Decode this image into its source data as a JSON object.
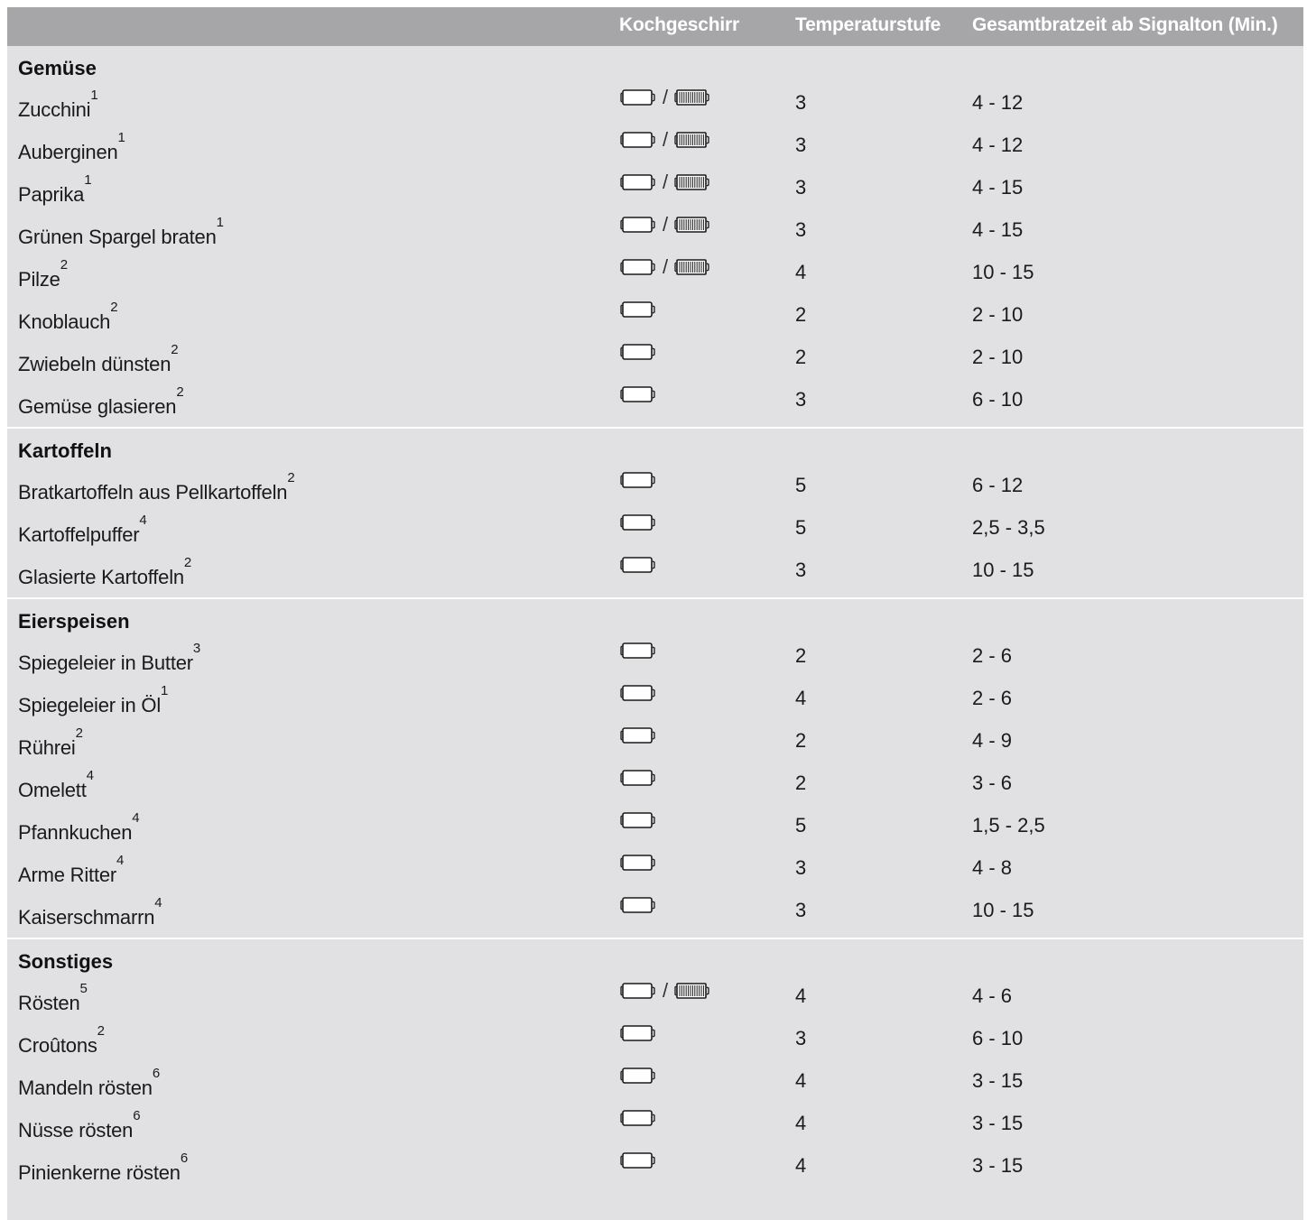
{
  "header": {
    "col1": "",
    "col2": "Kochgeschirr",
    "col3": "Temperaturstufe",
    "col4": "Gesamtbratzeit ab Signalton (Min.)"
  },
  "icons": {
    "pan": "pan-icon",
    "grill": "grill-pan-icon",
    "separator": "/"
  },
  "colors": {
    "header_bg": "#a6a6a8",
    "body_bg": "#e1e1e3",
    "header_text": "#ffffff"
  },
  "sections": [
    {
      "title": "Gemüse",
      "rows": [
        {
          "name": "Zucchini",
          "note": "1",
          "cookware": [
            "pan",
            "grill"
          ],
          "temp": "3",
          "time": "4 - 12"
        },
        {
          "name": "Auberginen",
          "note": "1",
          "cookware": [
            "pan",
            "grill"
          ],
          "temp": "3",
          "time": "4 - 12"
        },
        {
          "name": "Paprika",
          "note": "1",
          "cookware": [
            "pan",
            "grill"
          ],
          "temp": "3",
          "time": "4 - 15"
        },
        {
          "name": "Grünen Spargel braten",
          "note": "1",
          "cookware": [
            "pan",
            "grill"
          ],
          "temp": "3",
          "time": "4 - 15"
        },
        {
          "name": "Pilze",
          "note": "2",
          "cookware": [
            "pan",
            "grill"
          ],
          "temp": "4",
          "time": "10 - 15"
        },
        {
          "name": "Knoblauch",
          "note": "2",
          "cookware": [
            "pan"
          ],
          "temp": "2",
          "time": "2 - 10"
        },
        {
          "name": "Zwiebeln dünsten",
          "note": "2",
          "cookware": [
            "pan"
          ],
          "temp": "2",
          "time": "2 - 10"
        },
        {
          "name": "Gemüse glasieren",
          "note": "2",
          "cookware": [
            "pan"
          ],
          "temp": "3",
          "time": "6 - 10"
        }
      ]
    },
    {
      "title": "Kartoffeln",
      "rows": [
        {
          "name": "Bratkartoffeln aus Pellkartoffeln",
          "note": "2",
          "cookware": [
            "pan"
          ],
          "temp": "5",
          "time": "6 - 12"
        },
        {
          "name": "Kartoffelpuffer",
          "note": "4",
          "cookware": [
            "pan"
          ],
          "temp": "5",
          "time": "2,5 - 3,5"
        },
        {
          "name": "Glasierte Kartoffeln",
          "note": "2",
          "cookware": [
            "pan"
          ],
          "temp": "3",
          "time": "10 - 15"
        }
      ]
    },
    {
      "title": "Eierspeisen",
      "rows": [
        {
          "name": "Spiegeleier in Butter",
          "note": "3",
          "cookware": [
            "pan"
          ],
          "temp": "2",
          "time": "2 - 6"
        },
        {
          "name": "Spiegeleier in Öl",
          "note": "1",
          "cookware": [
            "pan"
          ],
          "temp": "4",
          "time": "2 - 6"
        },
        {
          "name": "Rührei",
          "note": "2",
          "cookware": [
            "pan"
          ],
          "temp": "2",
          "time": "4 - 9"
        },
        {
          "name": "Omelett",
          "note": "4",
          "cookware": [
            "pan"
          ],
          "temp": "2",
          "time": "3 - 6"
        },
        {
          "name": "Pfannkuchen",
          "note": "4",
          "cookware": [
            "pan"
          ],
          "temp": "5",
          "time": "1,5 - 2,5"
        },
        {
          "name": "Arme Ritter",
          "note": "4",
          "cookware": [
            "pan"
          ],
          "temp": "3",
          "time": "4 - 8"
        },
        {
          "name": "Kaiserschmarrn",
          "note": "4",
          "cookware": [
            "pan"
          ],
          "temp": "3",
          "time": "10 - 15"
        }
      ]
    },
    {
      "title": "Sonstiges",
      "rows": [
        {
          "name": "Rösten",
          "note": "5",
          "cookware": [
            "pan",
            "grill"
          ],
          "temp": "4",
          "time": "4 - 6"
        },
        {
          "name": "Croûtons",
          "note": "2",
          "cookware": [
            "pan"
          ],
          "temp": "3",
          "time": "6 - 10"
        },
        {
          "name": "Mandeln rösten",
          "note": "6",
          "cookware": [
            "pan"
          ],
          "temp": "4",
          "time": "3 - 15"
        },
        {
          "name": "Nüsse rösten",
          "note": "6",
          "cookware": [
            "pan"
          ],
          "temp": "4",
          "time": "3 - 15"
        },
        {
          "name": "Pinienkerne rösten",
          "note": "6",
          "cookware": [
            "pan"
          ],
          "temp": "4",
          "time": "3 - 15"
        }
      ]
    }
  ]
}
